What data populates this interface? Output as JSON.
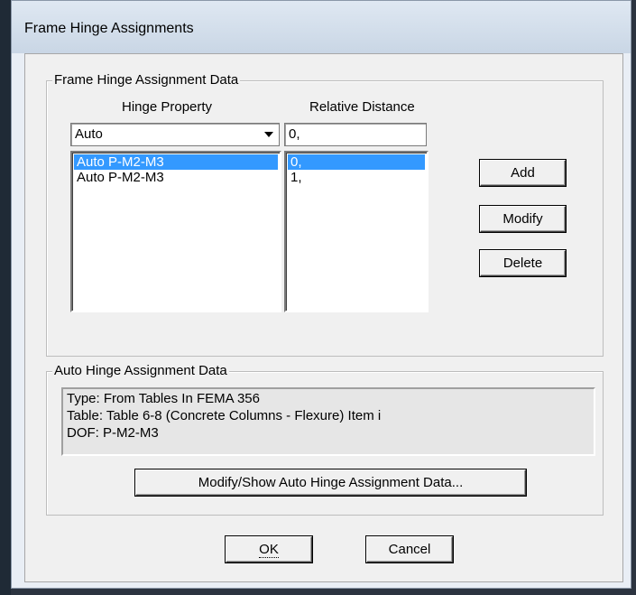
{
  "window": {
    "title": "Frame Hinge Assignments"
  },
  "hinge_group": {
    "title": "Frame Hinge Assignment Data",
    "hinge_property_label": "Hinge Property",
    "relative_distance_label": "Relative Distance",
    "hinge_property_value": "Auto",
    "relative_distance_value": "0,",
    "hinge_list": [
      "Auto  P-M2-M3",
      "Auto  P-M2-M3"
    ],
    "distance_list": [
      "0,",
      "1,"
    ],
    "selected_index": 0,
    "add_label": "Add",
    "modify_label": "Modify",
    "delete_label": "Delete"
  },
  "auto_group": {
    "title": "Auto Hinge Assignment Data",
    "lines": [
      "Type:  From Tables In FEMA 356",
      "Table:  Table 6-8 (Concrete Columns - Flexure) Item i",
      "DOF:  P-M2-M3"
    ],
    "modify_show_label": "Modify/Show Auto Hinge Assignment Data..."
  },
  "footer": {
    "ok_label": "OK",
    "cancel_label": "Cancel"
  }
}
